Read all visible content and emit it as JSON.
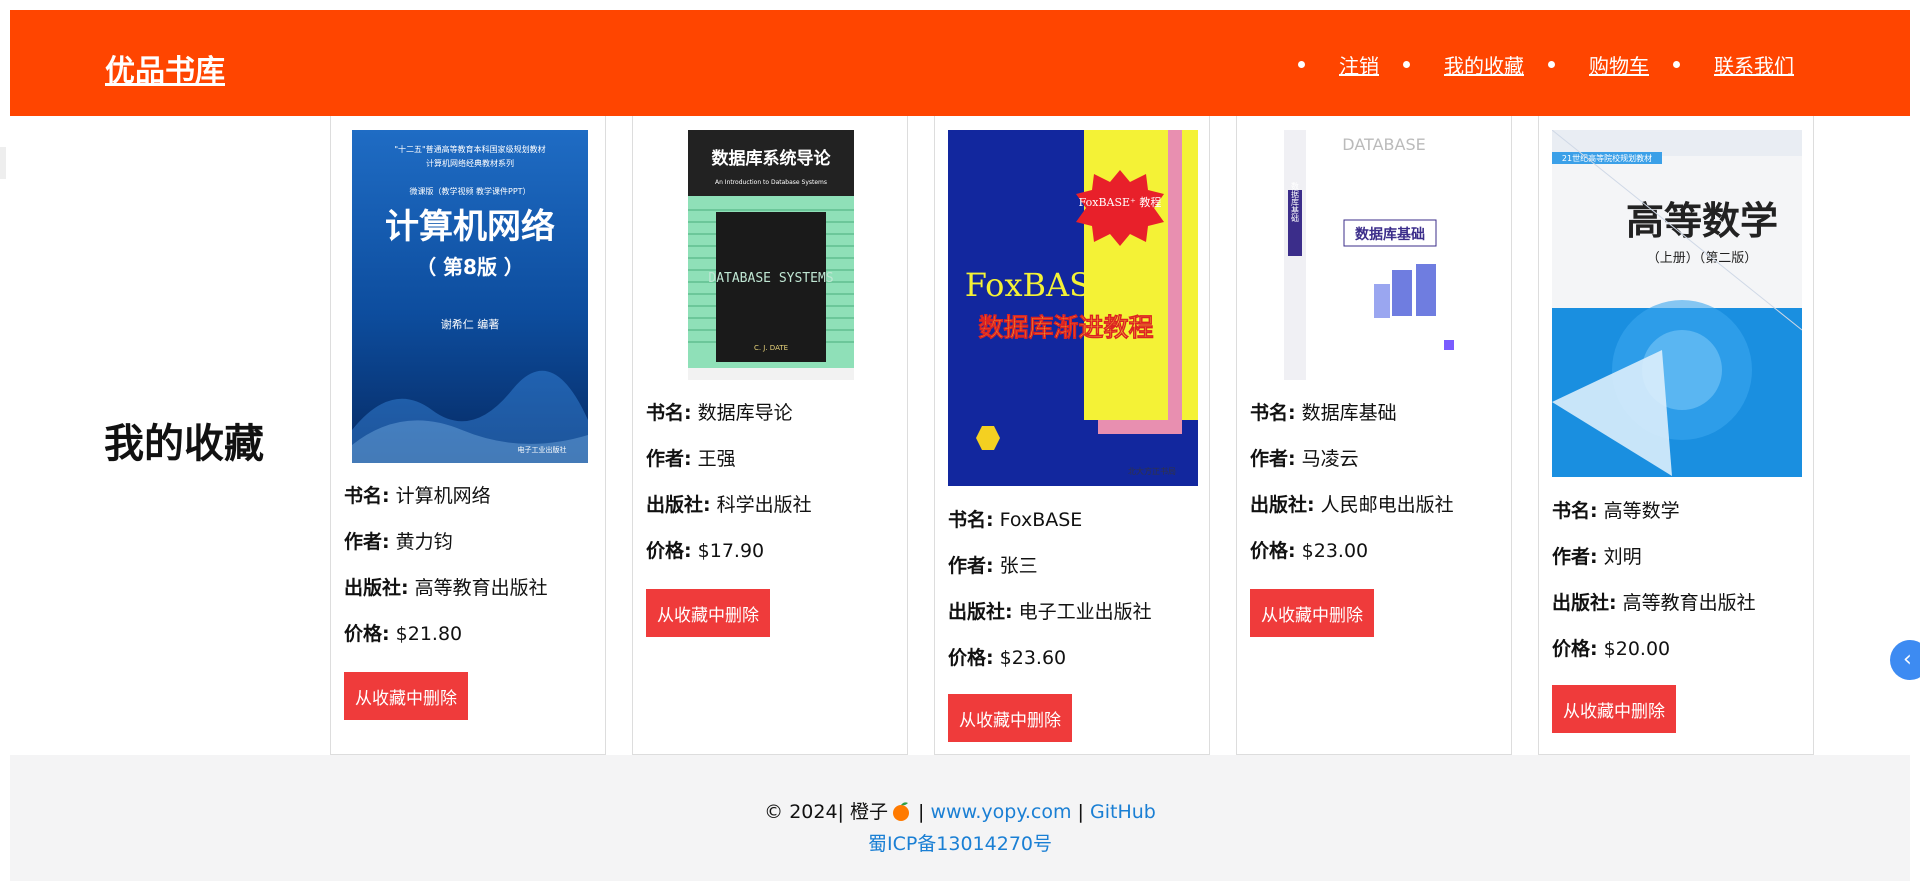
{
  "header": {
    "logo": "优品书库",
    "nav": [
      "注销",
      "我的收藏",
      "购物车",
      "联系我们"
    ]
  },
  "page_title": "我的收藏",
  "field_labels": {
    "name": "书名:",
    "author": "作者:",
    "publisher": "出版社:",
    "price": "价格:"
  },
  "remove_label": "从收藏中删除",
  "books": [
    {
      "name": "计算机网络",
      "author": "黄力钧",
      "publisher": "高等教育出版社",
      "price": "$21.80",
      "cover": {
        "series_top": "\"十二五\"普通高等教育本科国家级规划教材",
        "series": "计算机网络经典教材系列",
        "edition_note": "微课版（教学视频 教学课件PPT）",
        "title": "计算机网络",
        "edition": "（ 第8版 ）",
        "editor": "谢希仁 编著",
        "publisher": "电子工业出版社"
      }
    },
    {
      "name": "数据库导论",
      "author": "王强",
      "publisher": "科学出版社",
      "price": "$17.90",
      "cover": {
        "title": "数据库系统导论",
        "subtitle": "An Introduction to Database Systems",
        "inner_title": "DATABASE SYSTEMS",
        "author": "C. J. DATE"
      }
    },
    {
      "name": "FoxBASE",
      "author": "张三",
      "publisher": "电子工业出版社",
      "price": "$23.60",
      "cover": {
        "badge": "FoxBASE⁺ 教程",
        "title_en": "FoxBASE⁺",
        "title": "数据库渐进教程",
        "publisher": "北大方正书局"
      }
    },
    {
      "name": "数据库基础",
      "author": "马凌云",
      "publisher": "人民邮电出版社",
      "price": "$23.00",
      "cover": {
        "top_text": "DATABASE",
        "title": "数据库基础",
        "spine": "数据库基础"
      }
    },
    {
      "name": "高等数学",
      "author": "刘明",
      "publisher": "高等教育出版社",
      "price": "$20.00",
      "cover": {
        "series": "21世纪高等院校规划教材",
        "title": "高等数学",
        "subtitle": "（上册）（第二版）"
      }
    }
  ],
  "footer": {
    "copyright": "© 2024| 橙子",
    "separator": "|",
    "site_link": "www.yopy.com",
    "github_link": "GitHub",
    "icp": "蜀ICP备13014270号"
  },
  "colors": {
    "header": "#ff4500",
    "button": "#ef3b3b",
    "link": "#1a7fd4",
    "footer_bg": "#f4f4f5"
  },
  "side_button_icon": "chevron-left-icon"
}
